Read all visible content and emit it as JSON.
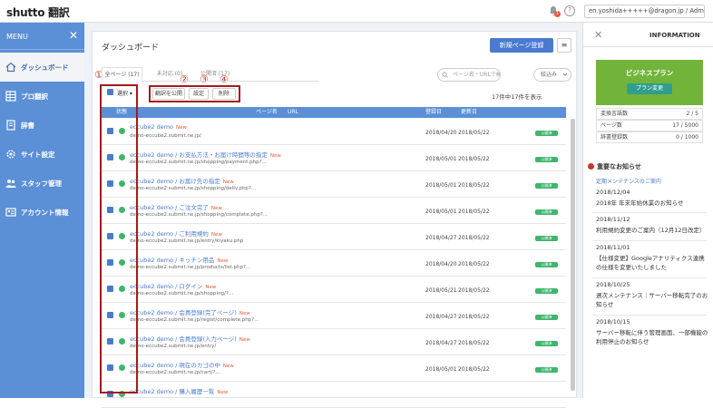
{
  "header": {
    "logo": "shutto 翻訳",
    "logo_sub": "",
    "notification_count": "1",
    "help": "?",
    "user": "en.yoshida+++++@dragon.jp / Admin"
  },
  "sidebar": {
    "menu_label": "MENU",
    "close": "✕",
    "items": [
      {
        "label": "ダッシュボード"
      },
      {
        "label": "プロ翻訳"
      },
      {
        "label": "辞書"
      },
      {
        "label": "サイト設定"
      },
      {
        "label": "スタッフ管理"
      },
      {
        "label": "アカウント情報"
      }
    ]
  },
  "main": {
    "title": "ダッシュボード",
    "new_page_button": "新規ページ登録",
    "menu_button": "≡",
    "tabs": [
      "全ページ (17)",
      "未対応 (0)",
      "公開済 (17)"
    ],
    "search_placeholder": "ページ名・URLで検索",
    "filter_label": "絞込み",
    "select_label": "選択",
    "action_buttons": [
      "翻訳を公開",
      "設定",
      "削除"
    ],
    "circled_numbers": [
      "①",
      "②",
      "③",
      "④"
    ],
    "count_text": "17件中17件を表示",
    "table_headers": {
      "status": "状態",
      "page_name": "ページ名",
      "url": "URL",
      "registered": "登録日",
      "updated": "更新日"
    },
    "rows": [
      {
        "title": "eccube2 demo",
        "new": "New",
        "url": "demo-eccube2.submit.ne.jp/",
        "registered": "2018/04/20",
        "updated": "2018/05/22",
        "badge": "公開済"
      },
      {
        "title": "eccube2 demo / お支払方法・お届け時間等の指定",
        "new": "New",
        "url": "demo-eccube2.submit.ne.jp/shopping/payment.php?...",
        "registered": "2018/05/01",
        "updated": "2018/05/22",
        "badge": "公開済"
      },
      {
        "title": "eccube2 demo / お届け先の指定",
        "new": "New",
        "url": "demo-eccube2.submit.ne.jp/shopping/deliv.php?...",
        "registered": "2018/05/01",
        "updated": "2018/05/22",
        "badge": "公開済"
      },
      {
        "title": "eccube2 demo / ご注文完了",
        "new": "New",
        "url": "demo-eccube2.submit.ne.jp/shopping/complete.php?...",
        "registered": "2018/05/01",
        "updated": "2018/05/22",
        "badge": "公開済"
      },
      {
        "title": "eccube2 demo / ご利用規約",
        "new": "New",
        "url": "demo-eccube2.submit.ne.jp/entry/kiyaku.php",
        "registered": "2018/04/27",
        "updated": "2018/05/22",
        "badge": "公開済"
      },
      {
        "title": "eccube2 demo / キッチン用品",
        "new": "New",
        "url": "demo-eccube2.submit.ne.jp/products/list.php?...",
        "registered": "2018/04/20",
        "updated": "2018/05/22",
        "badge": "公開済"
      },
      {
        "title": "eccube2 demo / ログイン",
        "new": "New",
        "url": "demo-eccube2.submit.ne.jp/shopping/?...",
        "registered": "2018/05/21",
        "updated": "2018/05/22",
        "badge": "公開済"
      },
      {
        "title": "eccube2 demo / 会員登録(完了ページ)",
        "new": "New",
        "url": "demo-eccube2.submit.ne.jp/regist/complete.php?...",
        "registered": "2018/04/27",
        "updated": "2018/05/22",
        "badge": "公開済"
      },
      {
        "title": "eccube2 demo / 会員登録(入力ページ)",
        "new": "New",
        "url": "demo-eccube2.submit.ne.jp/entry/",
        "registered": "2018/04/27",
        "updated": "2018/05/22",
        "badge": "公開済"
      },
      {
        "title": "eccube2 demo / 現在のカゴの中",
        "new": "New",
        "url": "demo-eccube2.submit.ne.jp/cart/?...",
        "registered": "2018/05/01",
        "updated": "2018/05/22",
        "badge": "公開済"
      },
      {
        "title": "eccube2 demo / 購入履歴一覧",
        "new": "New",
        "url": "",
        "registered": "",
        "updated": "",
        "badge": ""
      }
    ]
  },
  "info": {
    "close": "✕",
    "title": "INFORMATION",
    "plan_name": "ビジネスプラン",
    "plan_button": "プラン変更",
    "stats": [
      {
        "label": "変換言語数",
        "value": "2 / 5"
      },
      {
        "label": "ページ数",
        "value": "17 / 5000"
      },
      {
        "label": "辞書登録数",
        "value": "0 / 1000"
      }
    ],
    "news_heading": "重要なお知らせ",
    "news_link": "定期メンテナンスのご案内",
    "news": [
      {
        "date": "2018/12/04",
        "text": "2018年 年末年始休業のお知らせ"
      },
      {
        "date": "2018/11/12",
        "text": "利用規約変更のご案内（12月12日改定）"
      },
      {
        "date": "2018/11/01",
        "text": "【仕様変更】Googleアナリティクス連携の仕様を変更いたしました"
      },
      {
        "date": "2018/10/25",
        "text": "週次メンテナンス｜サーバー移転完了のお知らせ"
      },
      {
        "date": "2018/10/15",
        "text": "サーバー移転に伴う管理画面、一部機能の利用停止のお知らせ"
      }
    ]
  }
}
